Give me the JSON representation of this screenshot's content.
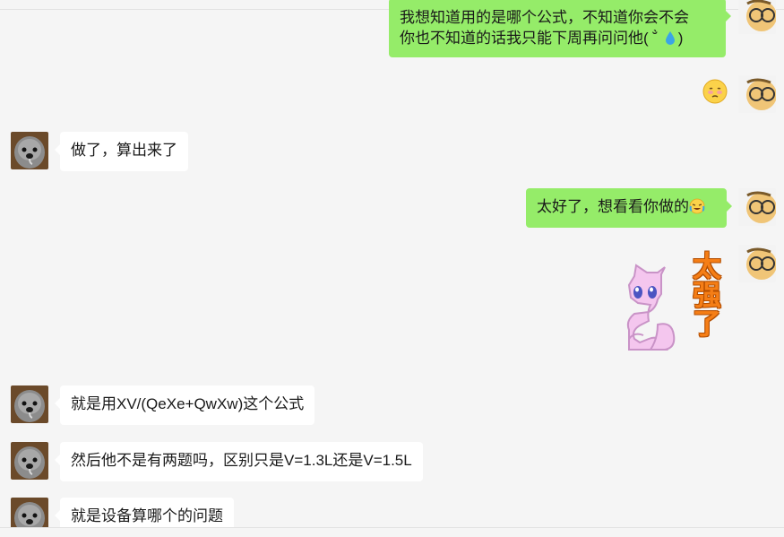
{
  "messages": [
    {
      "side": "out",
      "lines": [
        "我想知道用的是哪个公式，不知道你会不会",
        "你也不知道的话我只能下周再问问他( ˘̀ ",
        ")"
      ]
    },
    {
      "side": "out",
      "emoji": "face-with-halo-bashful-emoji"
    },
    {
      "side": "in",
      "text": "做了，算出来了"
    },
    {
      "side": "out",
      "text": "太好了，想看看你做的"
    },
    {
      "side": "out",
      "sticker_text": "太强了"
    },
    {
      "side": "in",
      "text": "就是用XV/(QeXe+QwXw)这个公式"
    },
    {
      "side": "in",
      "text": "然后他不是有两题吗，区别只是V=1.3L还是V=1.5L"
    },
    {
      "side": "in",
      "text": "就是设备算哪个的问题"
    }
  ],
  "colors": {
    "background": "#f5f5f5",
    "bubble_out": "#95ec69",
    "bubble_in": "#ffffff",
    "text": "#191919"
  }
}
